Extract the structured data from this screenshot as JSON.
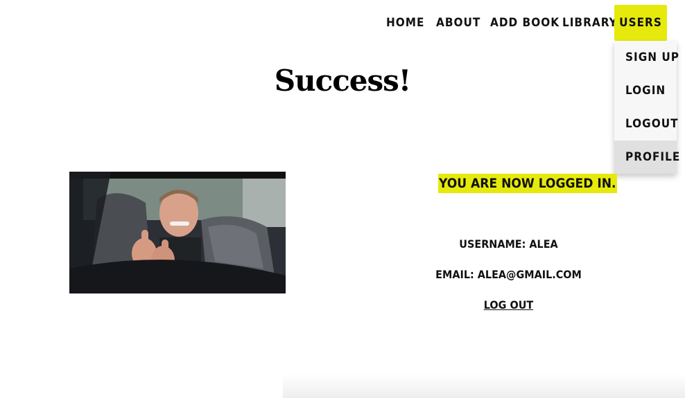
{
  "nav": {
    "home": "HOME",
    "about": "ABOUT",
    "add_book": "ADD BOOK",
    "library": "LIBRARY",
    "users": "USERS"
  },
  "dropdown": {
    "items": [
      "SIGN UP",
      "LOGIN",
      "LOGOUT",
      "PROFILE"
    ]
  },
  "page": {
    "title": "Success!",
    "status": "YOU ARE NOW LOGGED IN.",
    "username": "USERNAME: ALEA",
    "email": "EMAIL: ALEA@GMAIL.COM",
    "logout": "LOG OUT"
  },
  "colors": {
    "accent": "#e6ea0c"
  }
}
